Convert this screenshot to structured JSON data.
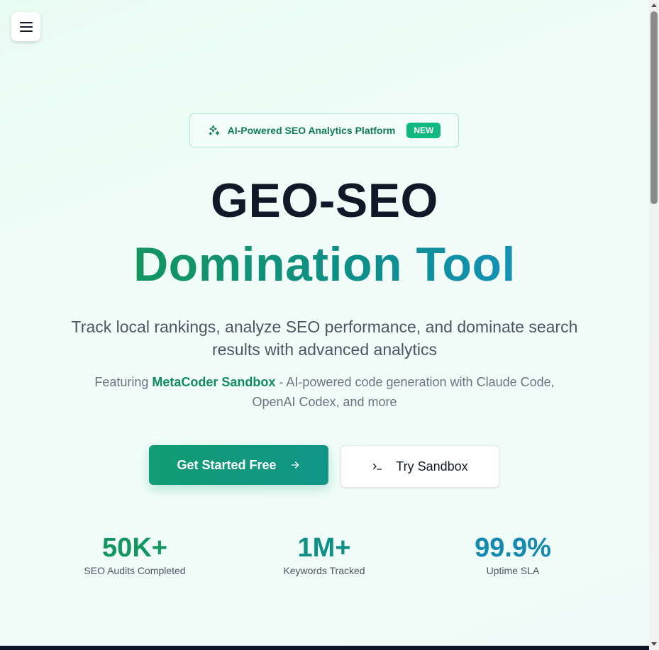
{
  "header": {
    "menu_icon": "hamburger-icon"
  },
  "badge": {
    "icon": "sparkles-icon",
    "label": "AI-Powered SEO Analytics Platform",
    "tag": "NEW"
  },
  "hero": {
    "title_line1": "GEO-SEO",
    "title_line2": "Domination Tool",
    "subtitle": "Track local rankings, analyze SEO performance, and dominate search results with advanced analytics",
    "feature_prefix": "Featuring ",
    "feature_highlight": "MetaCoder Sandbox",
    "feature_suffix": " - AI-powered code generation with Claude Code, OpenAI Codex, and more"
  },
  "cta": {
    "primary_label": "Get Started Free",
    "primary_icon": "arrow-right-icon",
    "secondary_label": "Try Sandbox",
    "secondary_icon": "terminal-icon"
  },
  "stats": [
    {
      "value": "50K+",
      "label": "SEO Audits Completed",
      "color": "#15955f"
    },
    {
      "value": "1M+",
      "label": "Keywords Tracked",
      "color": "#0f8f86"
    },
    {
      "value": "99.9%",
      "label": "Uptime SLA",
      "color": "#1689b0"
    }
  ],
  "colors": {
    "accent": "#10b981",
    "primary_button": "#119c73",
    "text_dark": "#111827"
  }
}
